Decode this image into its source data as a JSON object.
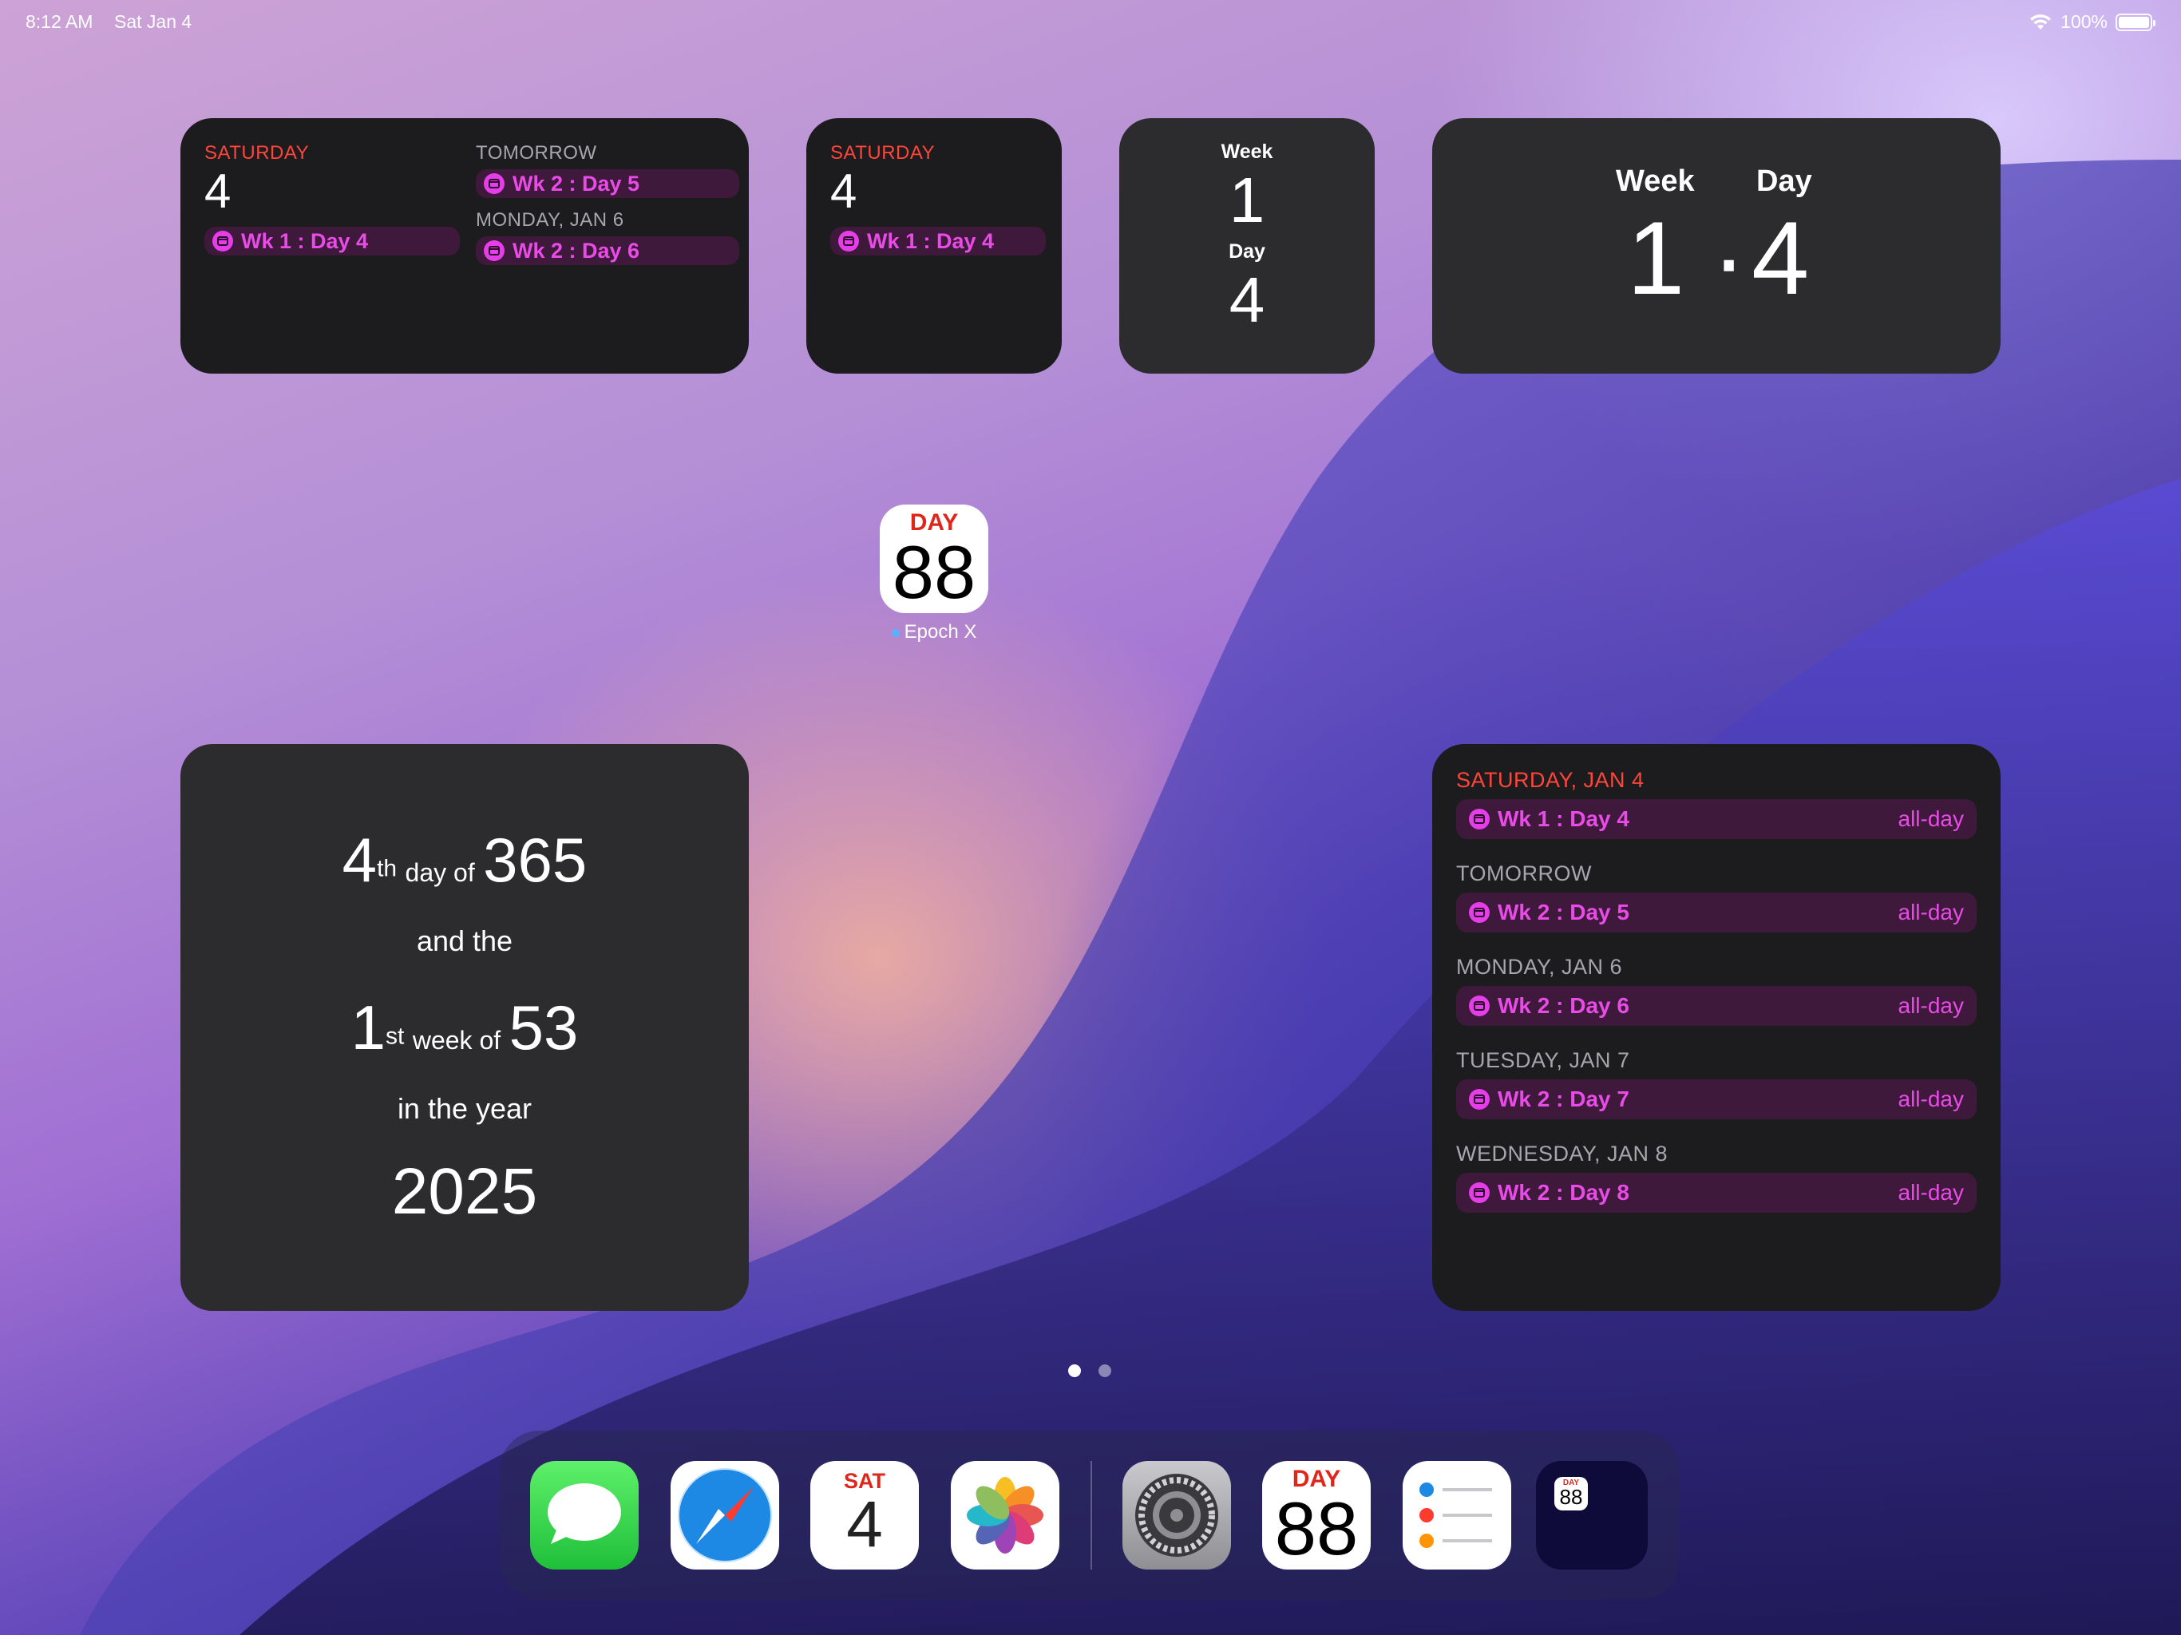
{
  "status": {
    "time": "8:12 AM",
    "date": "Sat Jan 4",
    "battery": "100%",
    "battery_level": 1.0
  },
  "w1": {
    "left_label": "SATURDAY",
    "left_day": "4",
    "left_event": "Wk 1 : Day 4",
    "tomorrow_label": "TOMORROW",
    "tomorrow_event": "Wk 2 : Day 5",
    "next_label": "MONDAY, JAN 6",
    "next_event": "Wk 2 : Day 6"
  },
  "w2": {
    "label": "SATURDAY",
    "day": "4",
    "event": "Wk 1 : Day 4"
  },
  "w3": {
    "week_label": "Week",
    "week": "1",
    "day_label": "Day",
    "day": "4"
  },
  "w4": {
    "week_label": "Week",
    "day_label": "Day",
    "week": "1",
    "sep": "·",
    "day": "4"
  },
  "epoch_app": {
    "top": "DAY",
    "num": "88",
    "name": "Epoch X"
  },
  "w5": {
    "day_num": "4",
    "day_suffix": "th",
    "day_of": "day of",
    "days_total": "365",
    "and_the": "and the",
    "week_num": "1",
    "week_suffix": "st",
    "week_of": "week of",
    "weeks_total": "53",
    "in_year": "in the year",
    "year": "2025"
  },
  "w6": {
    "sections": [
      {
        "label": "SATURDAY, JAN 4",
        "event": "Wk 1 : Day 4",
        "time": "all-day"
      },
      {
        "label": "TOMORROW",
        "event": "Wk 2 : Day 5",
        "time": "all-day"
      },
      {
        "label": "MONDAY, JAN 6",
        "event": "Wk 2 : Day 6",
        "time": "all-day"
      },
      {
        "label": "TUESDAY, JAN 7",
        "event": "Wk 2 : Day 7",
        "time": "all-day"
      },
      {
        "label": "WEDNESDAY, JAN 8",
        "event": "Wk 2 : Day 8",
        "time": "all-day"
      }
    ]
  },
  "dock": {
    "calendar_day": "SAT",
    "calendar_num": "4",
    "epoch_top": "DAY",
    "epoch_num": "88",
    "folder_top": "DAY",
    "folder_num": "88",
    "icons": [
      "messages-icon",
      "safari-icon",
      "calendar-icon",
      "photos-icon",
      "settings-icon",
      "epoch-x-icon",
      "reminders-icon",
      "app-folder-icon"
    ]
  },
  "colors": {
    "accent_red": "#ff453a",
    "event_pink": "#e53ee8",
    "widget_bg": "#1c1c1e"
  }
}
